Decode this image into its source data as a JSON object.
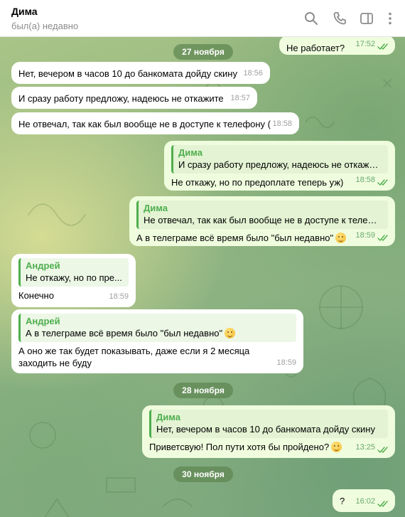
{
  "header": {
    "contact_name": "Дима",
    "status": "был(а) недавно",
    "icons": [
      "search-icon",
      "phone-icon",
      "sidebar-toggle-icon",
      "more-vertical-icon"
    ]
  },
  "colors": {
    "incoming_bubble": "#ffffff",
    "outgoing_bubble": "#effdde",
    "accent_green": "#4fae4e",
    "read_ticks": "#4fae4e"
  },
  "messages": [
    {
      "direction": "out",
      "text": "Не работает?",
      "time": "17:52",
      "read": true
    },
    {
      "type": "date",
      "text": "27 ноября"
    },
    {
      "direction": "in",
      "text": "Нет, вечером в часов 10 до банкомата дойду скину",
      "time": "18:56"
    },
    {
      "direction": "in",
      "text": "И сразу работу предложу, надеюсь не откажите",
      "time": "18:57"
    },
    {
      "direction": "in",
      "text": "Не отвечал, так как был вообще не в доступе к телефону (",
      "time": "18:58"
    },
    {
      "direction": "out",
      "reply_name": "Дима",
      "reply_text": "И сразу работу предложу, надеюсь не откажите",
      "text": "Не откажу, но по предоплате теперь уж)",
      "time": "18:58",
      "read": true
    },
    {
      "direction": "out",
      "reply_name": "Дима",
      "reply_text": "Не отвечал, так как был вообще не в доступе к телефо...",
      "text": "А в телеграме всё время было \"был недавно\"",
      "emoji": "thinking-face-emoji",
      "time": "18:59",
      "read": true
    },
    {
      "direction": "in",
      "reply_name": "Андрей",
      "reply_text": "Не откажу, но по пре...",
      "text": "Конечно",
      "time": "18:59"
    },
    {
      "direction": "in",
      "reply_name": "Андрей",
      "reply_text": "А в телеграме всё время было \"был недавно\"",
      "reply_emoji": "thinking-face-emoji",
      "text": "А оно же так будет показывать, даже если я 2 месяца заходить не буду",
      "time": "18:59"
    },
    {
      "type": "date",
      "text": "28 ноября"
    },
    {
      "direction": "out",
      "reply_name": "Дима",
      "reply_text": "Нет, вечером в часов 10 до банкомата дойду скину",
      "text": "Приветсвую! Пол пути хотя бы пройдено?",
      "emoji": "grinning-face-emoji",
      "time": "13:25",
      "read": true
    },
    {
      "type": "date",
      "text": "30 ноября"
    },
    {
      "direction": "out",
      "text": "?",
      "time": "16:02",
      "read": true
    }
  ]
}
